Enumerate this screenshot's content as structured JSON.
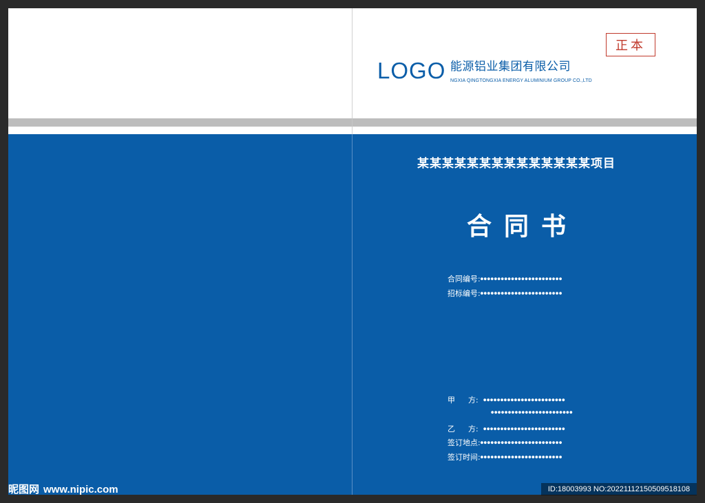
{
  "cover": {
    "stamp": "正本",
    "logo_text": "LOGO",
    "company_cn": "能源铝业集团有限公司",
    "company_en": "NGXIA QINGTONGXIA ENERGY ALUMINIUM GROUP CO.,LTD",
    "project": "某某某某某某某某某某某某某某项目",
    "title": "合同书",
    "fields": {
      "contract_no_label": "合同编号:",
      "tender_no_label": "招标编号:",
      "party_a_label_1": "甲",
      "party_a_label_2": "方:",
      "party_b_label_1": "乙",
      "party_b_label_2": "方:",
      "place_label": "签订地点:",
      "time_label": "签订时间:",
      "dots": "●●●●●●●●●●●●●●●●●●●●●●●●"
    }
  },
  "watermark": {
    "brand": "昵图网",
    "site": "www.nipic.com",
    "id_text": "ID:18003993 NO:20221112150509518108"
  }
}
